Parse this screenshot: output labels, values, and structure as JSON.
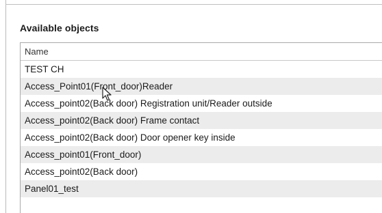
{
  "section": {
    "title": "Available objects"
  },
  "list": {
    "header": "Name",
    "items": [
      "TEST CH",
      "Access_Point01(Front_door)Reader",
      "Access_point02(Back door) Registration unit/Reader outside",
      "Access_point02(Back door) Frame contact",
      "Access_point02(Back door) Door opener key inside",
      "Access_point01(Front_door)",
      "Access_point02(Back door)",
      "Panel01_test"
    ]
  },
  "colors": {
    "alt_row": "#ececec",
    "border": "#a9a9a9"
  },
  "icons": {
    "cursor": "mouse-pointer-icon"
  }
}
